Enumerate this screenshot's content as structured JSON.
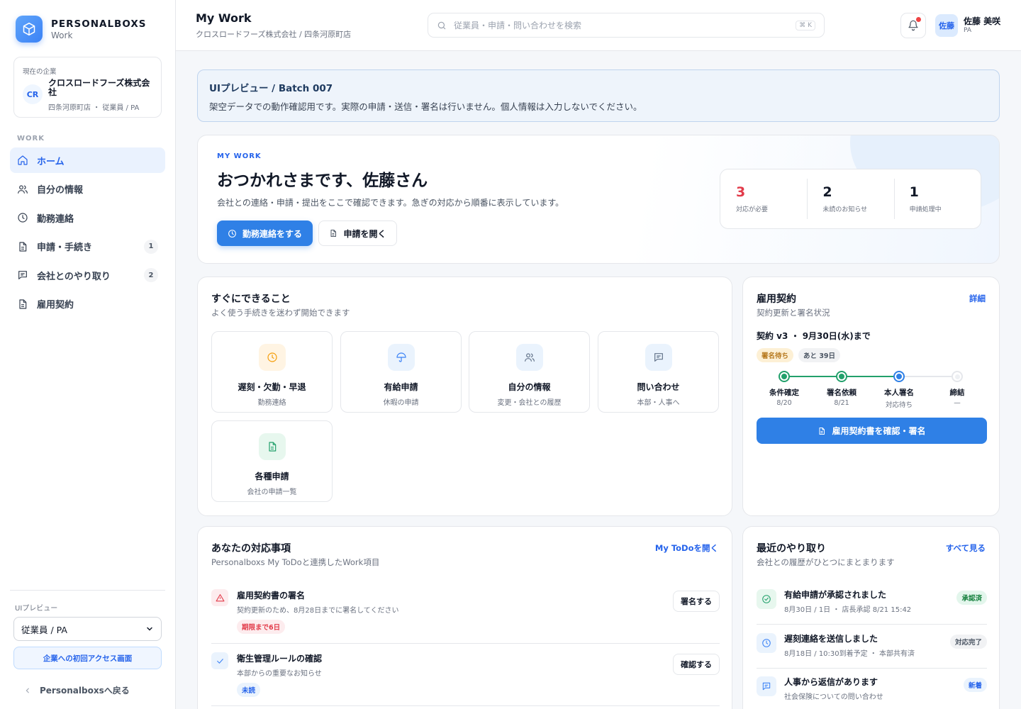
{
  "sidebar": {
    "brand_name": "PERSONALBOXS",
    "brand_sub": "Work",
    "company_label": "現在の企業",
    "company_initials": "CR",
    "company_name": "クロスロードフーズ株式会社",
    "company_meta": "四条河原町店 ・ 従業員 / PA",
    "section": "WORK",
    "items": [
      {
        "label": "ホーム",
        "badge": ""
      },
      {
        "label": "自分の情報",
        "badge": ""
      },
      {
        "label": "勤務連絡",
        "badge": ""
      },
      {
        "label": "申請・手続き",
        "badge": "1"
      },
      {
        "label": "会社とのやり取り",
        "badge": "2"
      },
      {
        "label": "雇用契約",
        "badge": ""
      }
    ],
    "preview_label": "UIプレビュー",
    "role_select": "従業員 / PA",
    "first_access_button": "企業への初回アクセス画面",
    "back_link": "Personalboxsへ戻る"
  },
  "header": {
    "title": "My Work",
    "subtitle": "クロスロードフーズ株式会社 / 四条河原町店",
    "search_placeholder": "従業員・申請・問い合わせを検索",
    "search_shortcut": "⌘ K",
    "user_initials": "佐藤",
    "user_name": "佐藤 美咲",
    "user_role": "PA"
  },
  "notice": {
    "title": "UIプレビュー / Batch 007",
    "text": "架空データでの動作確認用です。実際の申請・送信・署名は行いません。個人情報は入力しないでください。"
  },
  "hero": {
    "eyebrow": "MY WORK",
    "title": "おつかれさまです、佐藤さん",
    "description": "会社との連絡・申請・提出をここで確認できます。急ぎの対応から順番に表示しています。",
    "primary_button": "勤務連絡をする",
    "secondary_button": "申請を開く",
    "stats": [
      {
        "value": "3",
        "label": "対応が必要"
      },
      {
        "value": "2",
        "label": "未読のお知らせ"
      },
      {
        "value": "1",
        "label": "申請処理中"
      }
    ]
  },
  "quick_actions": {
    "title": "すぐにできること",
    "subtitle": "よく使う手続きを迷わず開始できます",
    "items": [
      {
        "name": "遅刻・欠勤・早退",
        "sub": "勤務連絡"
      },
      {
        "name": "有給申請",
        "sub": "休暇の申請"
      },
      {
        "name": "自分の情報",
        "sub": "変更・会社との履歴"
      },
      {
        "name": "問い合わせ",
        "sub": "本部・人事へ"
      },
      {
        "name": "各種申請",
        "sub": "会社の申請一覧"
      }
    ]
  },
  "contract": {
    "title": "雇用契約",
    "subtitle": "契約更新と署名状況",
    "link": "詳細",
    "heading": "契約 v3 ・ 9月30日(水)まで",
    "tags": [
      "署名待ち",
      "あと 39日"
    ],
    "steps": [
      {
        "name": "条件確定",
        "date": "8/20"
      },
      {
        "name": "署名依頼",
        "date": "8/21"
      },
      {
        "name": "本人署名",
        "date": "対応待ち"
      },
      {
        "name": "締結",
        "date": "—"
      }
    ],
    "button": "雇用契約書を確認・署名"
  },
  "todos": {
    "title": "あなたの対応事項",
    "subtitle": "Personalboxs My ToDoと連携したWork項目",
    "link": "My ToDoを開く",
    "items": [
      {
        "title": "雇用契約書の署名",
        "sub": "契約更新のため、8月28日までに署名してください",
        "tag": "期限まで6日",
        "button": "署名する"
      },
      {
        "title": "衛生管理ルールの確認",
        "sub": "本部からの重要なお知らせ",
        "tag": "未読",
        "button": "確認する"
      }
    ]
  },
  "activity": {
    "title": "最近のやり取り",
    "subtitle": "会社との履歴がひとつにまとまります",
    "link": "すべて見る",
    "items": [
      {
        "title": "有給申請が承認されました",
        "sub": "8月30日 / 1日 ・ 店長承認 8/21 15:42",
        "tag": "承認済"
      },
      {
        "title": "遅刻連絡を送信しました",
        "sub": "8月18日 / 10:30到着予定 ・ 本部共有済",
        "tag": "対応完了"
      },
      {
        "title": "人事から返信があります",
        "sub": "社会保険についての問い合わせ",
        "tag": "新着"
      }
    ]
  }
}
